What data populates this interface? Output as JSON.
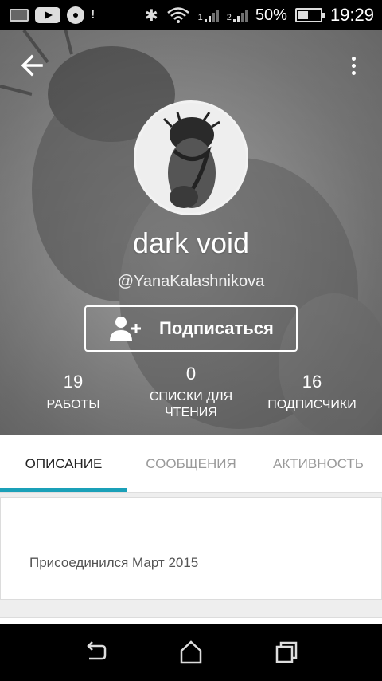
{
  "status_bar": {
    "battery": "50%",
    "time": "19:29",
    "sim1_label": "1",
    "sim2_label": "2",
    "notification_excl": "!"
  },
  "profile": {
    "display_name": "dark void",
    "username": "@YanaKalashnikova",
    "follow_button_label": "Подписаться"
  },
  "stats": {
    "works": {
      "value": "19",
      "label": "РАБОТЫ"
    },
    "reading_lists": {
      "value": "0",
      "label_line1": "СПИСКИ ДЛЯ",
      "label_line2": "ЧТЕНИЯ"
    },
    "followers": {
      "value": "16",
      "label": "ПОДПИСЧИКИ"
    }
  },
  "tabs": [
    {
      "label": "ОПИСАНИЕ",
      "active": true
    },
    {
      "label": "СООБЩЕНИЯ",
      "active": false
    },
    {
      "label": "АКТИВНОСТЬ",
      "active": false
    }
  ],
  "about": {
    "joined_text": "Присоединился Март 2015"
  },
  "colors": {
    "accent": "#1aa0b8",
    "status_bar": "#000000",
    "nav_bar": "#000000"
  },
  "icons": {
    "back": "arrow-left-icon",
    "more": "more-vertical-icon",
    "follow": "add-person-icon",
    "nav_back": "nav-back-icon",
    "nav_home": "nav-home-icon",
    "nav_recent": "nav-recents-icon"
  }
}
